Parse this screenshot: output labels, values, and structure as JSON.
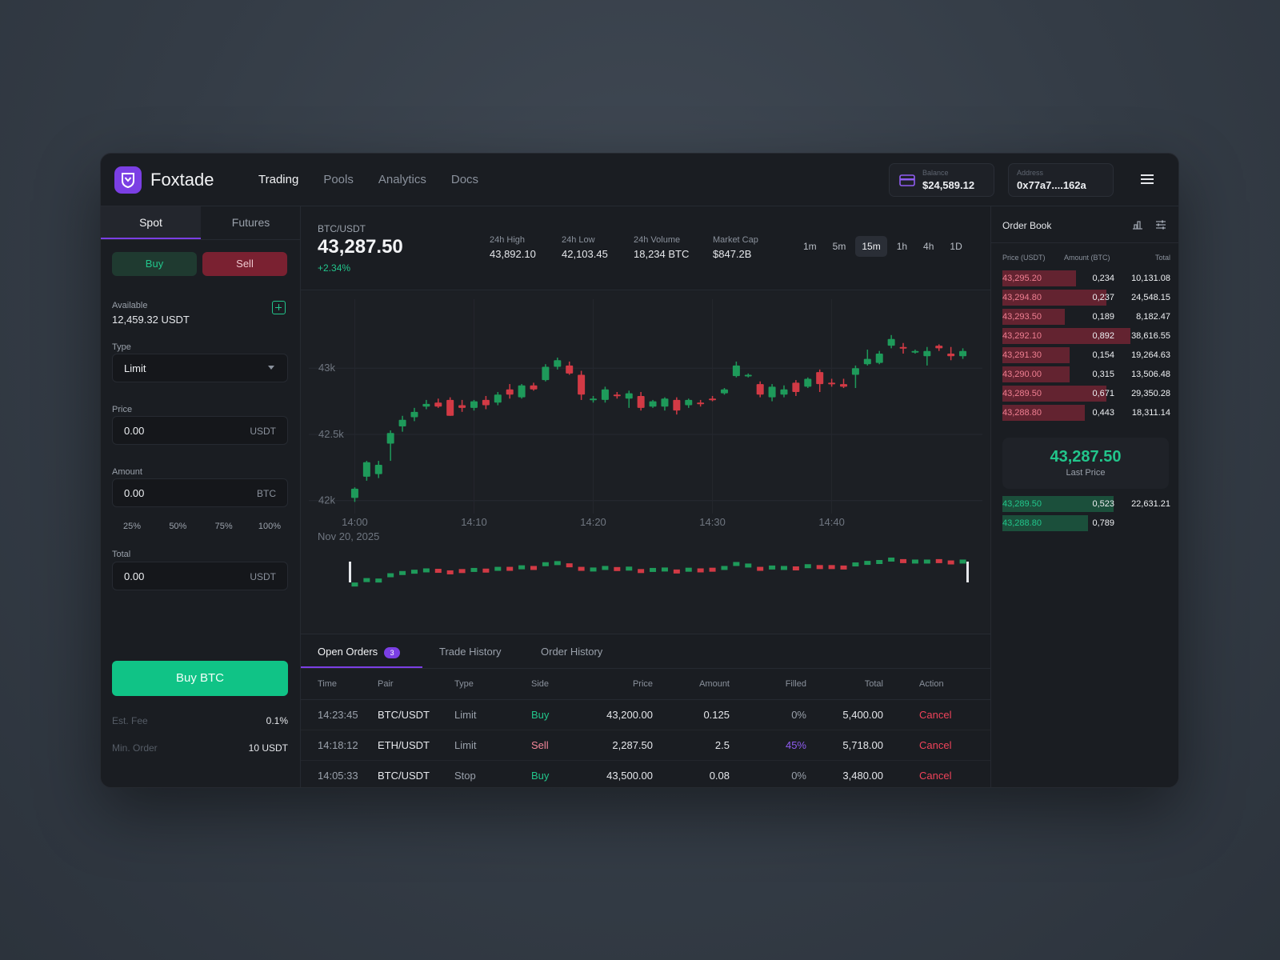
{
  "app": {
    "brand": "Foxtade"
  },
  "nav": [
    {
      "label": "Trading",
      "active": true
    },
    {
      "label": "Pools",
      "active": false
    },
    {
      "label": "Analytics",
      "active": false
    },
    {
      "label": "Docs",
      "active": false
    }
  ],
  "wallet": {
    "balance_label": "Balance",
    "balance_value": "$24,589.12",
    "address_label": "Address",
    "address_value": "0x77a7....162a"
  },
  "order_form": {
    "tabs": [
      "Spot",
      "Futures"
    ],
    "buy_label": "Buy",
    "sell_label": "Sell",
    "available_label": "Available",
    "available_value": "12,459.32 USDT",
    "type_label": "Type",
    "type_value": "Limit",
    "price_label": "Price",
    "price_value": "0.00",
    "price_unit": "USDT",
    "amount_label": "Amount",
    "amount_value": "0.00",
    "amount_unit": "BTC",
    "percents": [
      "25%",
      "50%",
      "75%",
      "100%"
    ],
    "total_label": "Total",
    "total_value": "0.00",
    "total_unit": "USDT",
    "submit_label": "Buy BTC",
    "fee_label": "Est. Fee",
    "fee_value": "0.1%",
    "min_label": "Min. Order",
    "min_value": "10 USDT"
  },
  "ticker": {
    "pair": "BTC/USDT",
    "price": "43,287.50",
    "change": "+2.34%",
    "stats": [
      {
        "label": "24h High",
        "value": "43,892.10"
      },
      {
        "label": "24h Low",
        "value": "42,103.45"
      },
      {
        "label": "24h Volume",
        "value": "18,234 BTC"
      },
      {
        "label": "Market Cap",
        "value": "$847.2B"
      }
    ],
    "timeframes": [
      "1m",
      "5m",
      "15m",
      "1h",
      "4h",
      "1D"
    ],
    "active_timeframe": "15m"
  },
  "chart_data": {
    "type": "candlestick",
    "y_ticks": [
      "43k",
      "42.5k",
      "42k"
    ],
    "x_ticks": [
      "14:00",
      "14:10",
      "14:20",
      "14:30",
      "14:40"
    ],
    "date_label": "Nov 20, 2025",
    "ylim": [
      41950,
      43400
    ],
    "colors": {
      "up": "#1e9a5a",
      "down": "#d23a45"
    },
    "candles": [
      {
        "o": 42020,
        "h": 42100,
        "l": 41990,
        "c": 42090
      },
      {
        "o": 42180,
        "h": 42300,
        "l": 42150,
        "c": 42290
      },
      {
        "o": 42200,
        "h": 42300,
        "l": 42170,
        "c": 42270
      },
      {
        "o": 42430,
        "h": 42530,
        "l": 42300,
        "c": 42510
      },
      {
        "o": 42560,
        "h": 42640,
        "l": 42520,
        "c": 42610
      },
      {
        "o": 42630,
        "h": 42700,
        "l": 42600,
        "c": 42670
      },
      {
        "o": 42710,
        "h": 42760,
        "l": 42690,
        "c": 42730
      },
      {
        "o": 42740,
        "h": 42770,
        "l": 42700,
        "c": 42710
      },
      {
        "o": 42760,
        "h": 42780,
        "l": 42640,
        "c": 42640
      },
      {
        "o": 42720,
        "h": 42760,
        "l": 42670,
        "c": 42700
      },
      {
        "o": 42700,
        "h": 42760,
        "l": 42680,
        "c": 42750
      },
      {
        "o": 42760,
        "h": 42790,
        "l": 42690,
        "c": 42720
      },
      {
        "o": 42740,
        "h": 42820,
        "l": 42720,
        "c": 42800
      },
      {
        "o": 42840,
        "h": 42880,
        "l": 42770,
        "c": 42800
      },
      {
        "o": 42780,
        "h": 42880,
        "l": 42770,
        "c": 42870
      },
      {
        "o": 42870,
        "h": 42890,
        "l": 42830,
        "c": 42840
      },
      {
        "o": 42910,
        "h": 43030,
        "l": 42900,
        "c": 43010
      },
      {
        "o": 43010,
        "h": 43080,
        "l": 42990,
        "c": 43060
      },
      {
        "o": 43020,
        "h": 43050,
        "l": 42950,
        "c": 42960
      },
      {
        "o": 42950,
        "h": 42980,
        "l": 42760,
        "c": 42800
      },
      {
        "o": 42760,
        "h": 42790,
        "l": 42740,
        "c": 42770
      },
      {
        "o": 42760,
        "h": 42860,
        "l": 42740,
        "c": 42840
      },
      {
        "o": 42800,
        "h": 42820,
        "l": 42770,
        "c": 42790
      },
      {
        "o": 42770,
        "h": 42830,
        "l": 42700,
        "c": 42810
      },
      {
        "o": 42790,
        "h": 42820,
        "l": 42680,
        "c": 42700
      },
      {
        "o": 42710,
        "h": 42760,
        "l": 42700,
        "c": 42750
      },
      {
        "o": 42710,
        "h": 42780,
        "l": 42680,
        "c": 42770
      },
      {
        "o": 42760,
        "h": 42780,
        "l": 42650,
        "c": 42680
      },
      {
        "o": 42720,
        "h": 42770,
        "l": 42700,
        "c": 42760
      },
      {
        "o": 42740,
        "h": 42760,
        "l": 42710,
        "c": 42730
      },
      {
        "o": 42770,
        "h": 42790,
        "l": 42750,
        "c": 42760
      },
      {
        "o": 42810,
        "h": 42850,
        "l": 42800,
        "c": 42840
      },
      {
        "o": 42940,
        "h": 43050,
        "l": 42930,
        "c": 43020
      },
      {
        "o": 42940,
        "h": 42960,
        "l": 42930,
        "c": 42950
      },
      {
        "o": 42880,
        "h": 42900,
        "l": 42780,
        "c": 42800
      },
      {
        "o": 42780,
        "h": 42880,
        "l": 42750,
        "c": 42860
      },
      {
        "o": 42800,
        "h": 42870,
        "l": 42780,
        "c": 42840
      },
      {
        "o": 42890,
        "h": 42910,
        "l": 42790,
        "c": 42820
      },
      {
        "o": 42860,
        "h": 42930,
        "l": 42850,
        "c": 42920
      },
      {
        "o": 42970,
        "h": 42990,
        "l": 42820,
        "c": 42880
      },
      {
        "o": 42890,
        "h": 42920,
        "l": 42860,
        "c": 42880
      },
      {
        "o": 42880,
        "h": 42920,
        "l": 42850,
        "c": 42860
      },
      {
        "o": 42950,
        "h": 43020,
        "l": 42850,
        "c": 43000
      },
      {
        "o": 43030,
        "h": 43140,
        "l": 43020,
        "c": 43070
      },
      {
        "o": 43040,
        "h": 43130,
        "l": 43030,
        "c": 43110
      },
      {
        "o": 43170,
        "h": 43250,
        "l": 43150,
        "c": 43220
      },
      {
        "o": 43160,
        "h": 43190,
        "l": 43110,
        "c": 43150
      },
      {
        "o": 43120,
        "h": 43140,
        "l": 43110,
        "c": 43130
      },
      {
        "o": 43090,
        "h": 43160,
        "l": 43020,
        "c": 43130
      },
      {
        "o": 43170,
        "h": 43180,
        "l": 43130,
        "c": 43150
      },
      {
        "o": 43110,
        "h": 43160,
        "l": 43060,
        "c": 43090
      },
      {
        "o": 43090,
        "h": 43150,
        "l": 43070,
        "c": 43130
      }
    ]
  },
  "orders": {
    "tabs": [
      "Open Orders",
      "Trade History",
      "Order History"
    ],
    "open_count": "3",
    "columns": [
      "Time",
      "Pair",
      "Type",
      "Side",
      "Price",
      "Amount",
      "Filled",
      "Total",
      "Action"
    ],
    "rows": [
      {
        "time": "14:23:45",
        "pair": "BTC/USDT",
        "type": "Limit",
        "side": "Buy",
        "price": "43,200.00",
        "amount": "0.125",
        "filled": "0%",
        "total": "5,400.00",
        "action": "Cancel"
      },
      {
        "time": "14:18:12",
        "pair": "ETH/USDT",
        "type": "Limit",
        "side": "Sell",
        "price": "2,287.50",
        "amount": "2.5",
        "filled": "45%",
        "total": "5,718.00",
        "action": "Cancel"
      },
      {
        "time": "14:05:33",
        "pair": "BTC/USDT",
        "type": "Stop",
        "side": "Buy",
        "price": "43,500.00",
        "amount": "0.08",
        "filled": "0%",
        "total": "3,480.00",
        "action": "Cancel"
      }
    ]
  },
  "order_book": {
    "title": "Order Book",
    "columns": [
      "Price (USDT)",
      "Amount (BTC)",
      "Total"
    ],
    "asks": [
      {
        "price": "43,295.20",
        "amount": "0,234",
        "total": "10,131.08",
        "depth": 0.44
      },
      {
        "price": "43,294.80",
        "amount": "0,237",
        "total": "24,548.15",
        "depth": 0.62
      },
      {
        "price": "43,293.50",
        "amount": "0,189",
        "total": "8,182.47",
        "depth": 0.37
      },
      {
        "price": "43,292.10",
        "amount": "0,892",
        "total": "38,616.55",
        "depth": 0.76
      },
      {
        "price": "43,291.30",
        "amount": "0,154",
        "total": "19,264.63",
        "depth": 0.4
      },
      {
        "price": "43,290.00",
        "amount": "0,315",
        "total": "13,506.48",
        "depth": 0.4
      },
      {
        "price": "43,289.50",
        "amount": "0,671",
        "total": "29,350.28",
        "depth": 0.62
      },
      {
        "price": "43,288.80",
        "amount": "0,443",
        "total": "18,311.14",
        "depth": 0.49
      }
    ],
    "last_price": "43,287.50",
    "last_label": "Last Price",
    "bids": [
      {
        "price": "43,289.50",
        "amount": "0,523",
        "total": "22,631.21",
        "depth": 0.66
      },
      {
        "price": "43,288.80",
        "amount": "0,789",
        "total": "",
        "depth": 0.51
      }
    ]
  }
}
